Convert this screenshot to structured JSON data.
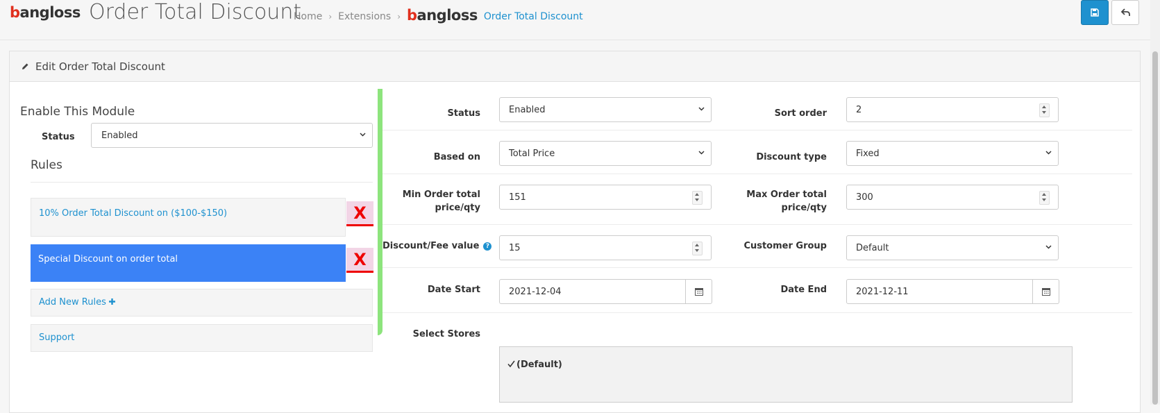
{
  "header": {
    "brand": {
      "first": "b",
      "rest": "angloss"
    },
    "title": "Order Total Discount",
    "breadcrumb": {
      "home": "Home",
      "extensions": "Extensions",
      "current": "Order Total Discount"
    },
    "save_icon": "save-icon",
    "back_icon": "back-arrow-icon",
    "primary_color": "#1e91cf"
  },
  "panel": {
    "heading": "Edit Order Total Discount",
    "heading_icon": "pencil-icon"
  },
  "sidebar": {
    "enable_title": "Enable This Module",
    "status_label": "Status",
    "status_value": "Enabled",
    "rules_title": "Rules",
    "rules": [
      {
        "label": "10% Order Total Discount on ($100-$150)",
        "active": false,
        "delete": "X"
      },
      {
        "label": "Special Discount on order total",
        "active": true,
        "delete": "X"
      }
    ],
    "add_rules": "Add New Rules",
    "support": "Support",
    "active_color": "#3b82f6",
    "accent_bar_color": "#8de47d"
  },
  "form": {
    "status": {
      "label": "Status",
      "value": "Enabled"
    },
    "sort_order": {
      "label": "Sort order",
      "value": "2"
    },
    "based_on": {
      "label": "Based on",
      "value": "Total Price"
    },
    "discount_type": {
      "label": "Discount type",
      "value": "Fixed"
    },
    "min_order": {
      "label_1": "Min Order total",
      "label_2": "price/qty",
      "value": "151"
    },
    "max_order": {
      "label_1": "Max Order total",
      "label_2": "price/qty",
      "value": "300"
    },
    "discount_value": {
      "label": "Discount/Fee value",
      "value": "15",
      "help": "?"
    },
    "customer_group": {
      "label": "Customer Group",
      "value": "Default"
    },
    "date_start": {
      "label": "Date Start",
      "value": "2021-12-04"
    },
    "date_end": {
      "label": "Date End",
      "value": "2021-12-11"
    },
    "stores": {
      "label": "Select Stores",
      "option": "(Default)",
      "checked": true
    }
  }
}
